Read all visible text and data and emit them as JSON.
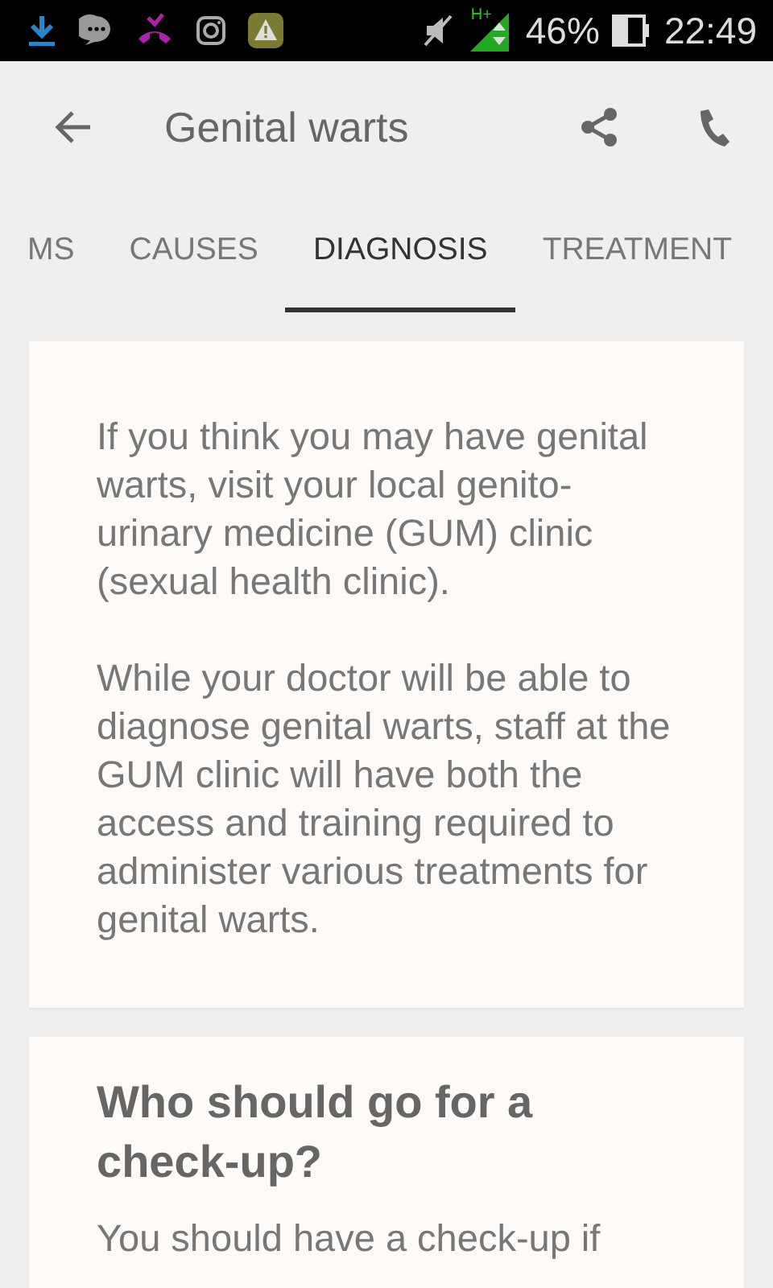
{
  "status_bar": {
    "battery": "46%",
    "time": "22:49",
    "network": "H+"
  },
  "app_bar": {
    "title": "Genital warts"
  },
  "tabs": [
    {
      "label": "MS",
      "selected": false
    },
    {
      "label": "CAUSES",
      "selected": false
    },
    {
      "label": "DIAGNOSIS",
      "selected": true
    },
    {
      "label": "TREATMENT",
      "selected": false
    }
  ],
  "cards": [
    {
      "paragraphs": [
        "If you think you may have genital warts, visit your local genito-urinary medicine (GUM) clinic (sexual health clinic).",
        "While your doctor will be able to diagnose genital warts, staff at the GUM clinic will have both the access and training required to administer various treatments for genital warts."
      ]
    },
    {
      "heading": "Who should go for a check-up?",
      "paragraphs": [
        "You should have a check-up if"
      ]
    }
  ]
}
